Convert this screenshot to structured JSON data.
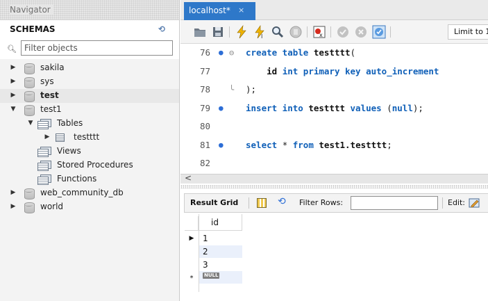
{
  "navigator": {
    "header_title": "Navigator",
    "schemas_label": "SCHEMAS",
    "filter_placeholder": "Filter objects",
    "schemas": [
      {
        "name": "sakila",
        "expanded": false,
        "bold": false
      },
      {
        "name": "sys",
        "expanded": false,
        "bold": false
      },
      {
        "name": "test",
        "expanded": false,
        "bold": true,
        "selected": true
      },
      {
        "name": "test1",
        "expanded": true,
        "bold": false
      },
      {
        "name": "web_community_db",
        "expanded": false,
        "bold": false
      },
      {
        "name": "world",
        "expanded": false,
        "bold": false
      }
    ],
    "test1_children": {
      "tables_label": "Tables",
      "table_name": "testttt",
      "views_label": "Views",
      "procedures_label": "Stored Procedures",
      "functions_label": "Functions"
    }
  },
  "editor": {
    "tab_label": "localhost*",
    "tab_close": "×",
    "limit_label": "Limit to 1",
    "lines": [
      {
        "num": "76",
        "dot": true,
        "fold": "⊖",
        "parts": [
          [
            "kw",
            "create table "
          ],
          [
            "nm",
            "testttt"
          ],
          [
            "",
            "("
          ]
        ]
      },
      {
        "num": "77",
        "dot": false,
        "fold": "",
        "parts": [
          [
            "",
            "    "
          ],
          [
            "nm",
            "id "
          ],
          [
            "kw",
            "int primary key auto_increment"
          ]
        ]
      },
      {
        "num": "78",
        "dot": false,
        "fold": "╰",
        "parts": [
          [
            "",
            ");"
          ]
        ]
      },
      {
        "num": "79",
        "dot": true,
        "fold": "",
        "parts": [
          [
            "kw",
            "insert into "
          ],
          [
            "nm",
            "testttt "
          ],
          [
            "kw",
            "values "
          ],
          [
            "",
            "("
          ],
          [
            "kw",
            "null"
          ],
          [
            "",
            ");"
          ]
        ]
      },
      {
        "num": "80",
        "dot": false,
        "fold": "",
        "parts": []
      },
      {
        "num": "81",
        "dot": true,
        "fold": "",
        "parts": [
          [
            "kw",
            "select "
          ],
          [
            "",
            "* "
          ],
          [
            "kw",
            "from "
          ],
          [
            "nm",
            "test1.testttt"
          ],
          [
            "",
            ";"
          ]
        ]
      },
      {
        "num": "82",
        "dot": false,
        "fold": "",
        "parts": []
      }
    ],
    "scroll_left": "<"
  },
  "result": {
    "result_grid_label": "Result Grid",
    "filter_rows_label": "Filter Rows:",
    "edit_label": "Edit:",
    "columns": [
      "id"
    ],
    "rows": [
      "1",
      "2",
      "3"
    ],
    "null_label": "NULL",
    "current_row_marker": "▶",
    "new_row_marker": "*",
    "highlight_color": "#eaf0fb"
  }
}
